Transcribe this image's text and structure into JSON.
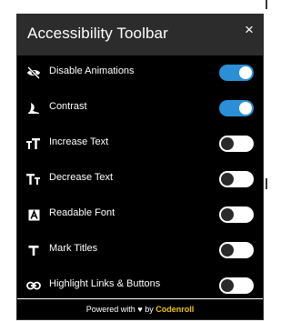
{
  "toolbar": {
    "title": "Accessibility Toolbar",
    "close_label": "×",
    "items": [
      {
        "icon": "eye-slash-icon",
        "label": "Disable Animations",
        "on": true
      },
      {
        "icon": "contrast-icon",
        "label": "Contrast",
        "on": true
      },
      {
        "icon": "text-increase-icon",
        "glyph": "ᴛT",
        "label": "Increase Text",
        "on": false
      },
      {
        "icon": "text-decrease-icon",
        "glyph": "Tᴛ",
        "label": "Decrease Text",
        "on": false
      },
      {
        "icon": "readable-font-icon",
        "glyph": "A",
        "label": "Readable Font",
        "on": false
      },
      {
        "icon": "mark-titles-icon",
        "glyph": "T",
        "label": "Mark Titles",
        "on": false
      },
      {
        "icon": "link-icon",
        "label": "Highlight Links & Buttons",
        "on": false
      }
    ],
    "footer": {
      "prefix": "Powered with",
      "heart": "♥",
      "by": "by",
      "brand": "Codenroll"
    }
  },
  "colors": {
    "panel_bg": "#000000",
    "header_bg": "#2c2c2c",
    "toggle_on": "#2a8fd6",
    "toggle_off": "#ffffff",
    "brand": "#f1c40f"
  }
}
